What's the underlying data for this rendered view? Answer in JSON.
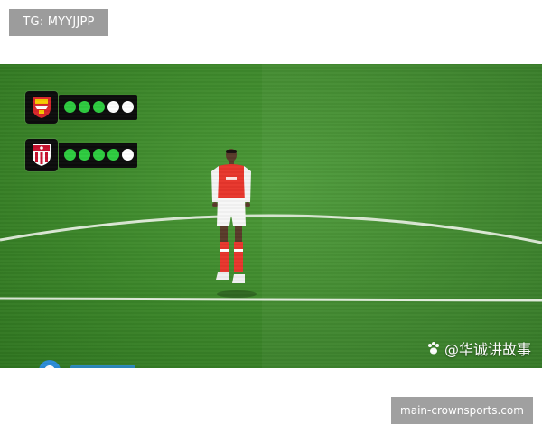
{
  "top_tag": "TG: MYYJJPP",
  "bottom_badge": "main-crownsports.com",
  "watermark": {
    "text": "@华诚讲故事",
    "icon": "paw-icon"
  },
  "form_panels": [
    {
      "crest": "arsenal-crest-icon",
      "dots": [
        "green",
        "green",
        "green",
        "white",
        "white"
      ]
    },
    {
      "crest": "athletic-club-crest-icon",
      "dots": [
        "green",
        "green",
        "green",
        "green",
        "white"
      ]
    }
  ],
  "colors": {
    "form_green": "#2ecc40",
    "form_white": "#ffffff",
    "kit_red": "#e8362c",
    "pitch_green": "#3b8529"
  }
}
